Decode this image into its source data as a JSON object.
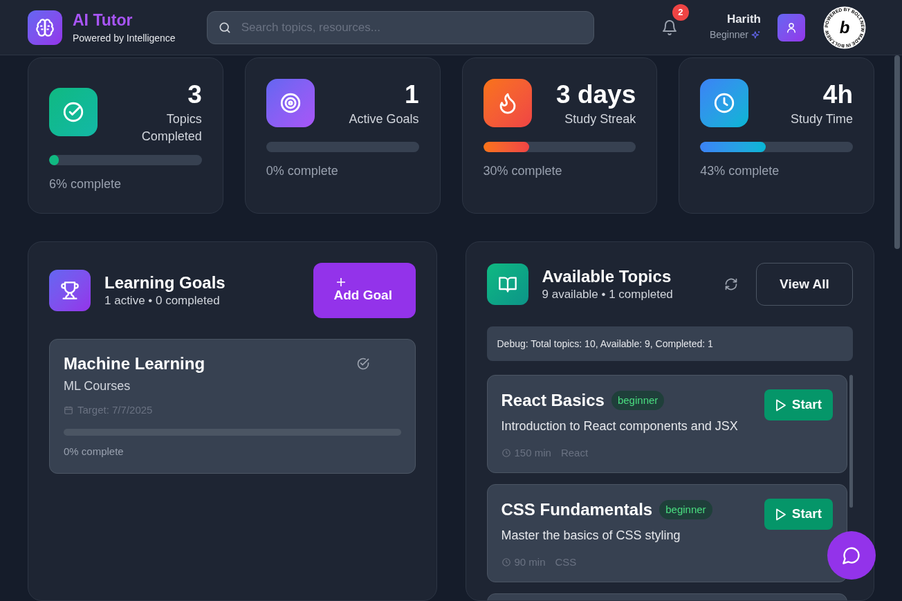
{
  "header": {
    "app_name": "AI Tutor",
    "tagline": "Powered by Intelligence",
    "search": {
      "placeholder": "Search topics, resources..."
    },
    "notifications": "2",
    "user": {
      "name": "Harith",
      "level": "Beginner"
    },
    "badge": {
      "letter": "b",
      "ring_text": "POWERED BY BOLT.NEW MADE IN BOLT.NEW"
    }
  },
  "stats": [
    {
      "kind": "check",
      "value": "3",
      "label": "Topics Completed",
      "level": 0.06,
      "progress": "6% complete"
    },
    {
      "kind": "target",
      "value": "1",
      "label": "Active Goals",
      "level": 0,
      "progress": "0% complete"
    },
    {
      "kind": "flame",
      "value": "3 days",
      "label": "Study Streak",
      "level": 0.3,
      "progress": "30% complete"
    },
    {
      "kind": "clock",
      "value": "4h",
      "label": "Study Time",
      "level": 0.43,
      "progress": "43% complete"
    }
  ],
  "goals": {
    "title": "Learning Goals",
    "summary": "1 active • 0 completed",
    "add_button": "Add Goal",
    "items": [
      {
        "title": "Machine Learning",
        "subtitle": "ML Courses",
        "target": "Target: 7/7/2025",
        "level": 0,
        "progress": "0% complete"
      }
    ]
  },
  "topics": {
    "title": "Available Topics",
    "summary": "9 available • 1 completed",
    "view_all": "View All",
    "debug": "Debug: Total topics: 10, Available: 9, Completed: 1",
    "items": [
      {
        "title": "React Basics",
        "difficulty": "beginner",
        "description": "Introduction to React components and JSX",
        "duration": "150 min",
        "category": "React",
        "action": "Start"
      },
      {
        "title": "CSS Fundamentals",
        "difficulty": "beginner",
        "description": "Master the basics of CSS styling",
        "duration": "90 min",
        "category": "CSS",
        "action": "Start"
      }
    ]
  }
}
